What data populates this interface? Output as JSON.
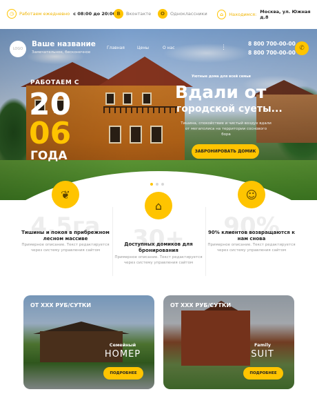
{
  "topbar": {
    "hours_label": "Работаем ежедневно",
    "hours_value": "с 08:00 до 20:00",
    "social1": "Вконтакте",
    "social2": "Одноклассники",
    "address_label": "Находимся:",
    "address_value": "Москва, ул. Южная д.8"
  },
  "header": {
    "logo_text": "LOGO",
    "brand_name": "Ваше название",
    "brand_sub": "Замечательное, бесконечное",
    "nav": [
      "Главная",
      "Цены",
      "О нас"
    ],
    "more": "⋮",
    "phones": [
      "8 800 700-00-00",
      "8 800 700-00-00"
    ]
  },
  "hero": {
    "since": "РАБОТАЕМ С",
    "year_top": "20",
    "year_bottom": "06",
    "years_label": "ГОДА",
    "tagline": "Уютные дома для всей семьи",
    "title_line1": "Вдали от",
    "title_line2": "городской суеты...",
    "description": "Тишина, спокойствие и чистый воздух вдали от мегаполиса на территории соснового бора",
    "cta": "ЗАБРОНИРОВАТЬ ДОМИК"
  },
  "slider": {
    "count": 3,
    "active": 1
  },
  "features": [
    {
      "bg_number": "4.5га",
      "title": "Тишины и покоя в прибрежном лесном массиве",
      "desc": "Примерное описание. Текст редактируется через систему управления сайтом"
    },
    {
      "bg_number": "30+",
      "title": "Доступных домиков для бронирования",
      "desc": "Примерное описание. Текст редактируется через систему управления сайтом"
    },
    {
      "bg_number": "90%",
      "title": "90% клиентов возвращаются к нам снова",
      "desc": "Примерное описание. Текст редактируется через систему управления сайтом"
    }
  ],
  "offers": [
    {
      "price": "ОТ XXX РУБ/СУТКИ",
      "subtitle": "Семейный",
      "type": "НОМЕР",
      "button": "ПОДРОБНЕЕ"
    },
    {
      "price": "ОТ XXX РУБ/СУТКИ",
      "subtitle": "Family",
      "type": "SUIT",
      "button": "ПОДРОБНЕЕ"
    }
  ],
  "colors": {
    "accent": "#ffc400",
    "text": "#222222",
    "muted": "#9a9a9a"
  },
  "icons": [
    "clock-icon",
    "vk-icon",
    "ok-icon",
    "location-icon",
    "phone-icon",
    "feature-icon"
  ]
}
